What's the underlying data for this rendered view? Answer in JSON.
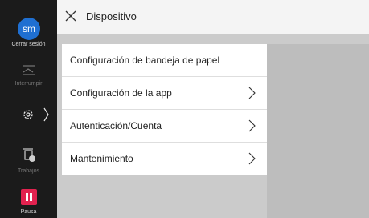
{
  "sidebar": {
    "avatar_initials": "sm",
    "logout_label": "Cerrar sesión",
    "interrupt_label": "Interrumpir",
    "jobs_label": "Trabajos",
    "pause_label": "Pausa",
    "pause_color": "#e2224f",
    "avatar_color": "#1f6fd1"
  },
  "header": {
    "title": "Dispositivo"
  },
  "menu": {
    "items": [
      {
        "label": "Configuración de bandeja de papel",
        "has_chevron": false
      },
      {
        "label": "Configuración de la app",
        "has_chevron": true
      },
      {
        "label": "Autenticación/Cuenta",
        "has_chevron": true
      },
      {
        "label": "Mantenimiento",
        "has_chevron": true
      }
    ]
  }
}
